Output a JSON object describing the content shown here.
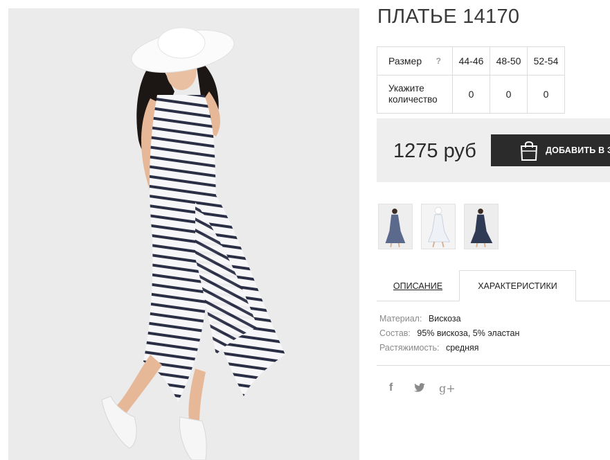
{
  "product": {
    "title": "ПЛАТЬЕ 14170",
    "price": "1275 руб",
    "add_to_cart_label": "ДОБАВИТЬ В ЗАКАЗ"
  },
  "size_table": {
    "size_label": "Размер",
    "help_mark": "?",
    "quantity_label": "Укажите количество",
    "sizes": [
      "44-46",
      "48-50",
      "52-54"
    ],
    "quantities": [
      "0",
      "0",
      "0"
    ]
  },
  "tabs": {
    "description": "ОПИСАНИЕ",
    "characteristics": "ХАРАКТЕРИСТИКИ",
    "active": "characteristics"
  },
  "characteristics": [
    {
      "key": "Материал:",
      "value": "Вискоза"
    },
    {
      "key": "Состав:",
      "value": "95% вискоза, 5% эластан"
    },
    {
      "key": "Растяжимость:",
      "value": "средняя"
    }
  ],
  "social": {
    "facebook": "f",
    "twitter": "twitter-bird",
    "googleplus": "g+"
  },
  "icons": {
    "cart": "shopping-bag-icon"
  },
  "colors": {
    "button_bg": "#2b2b2b",
    "price_block_bg": "#eeeeee",
    "border": "#dcdcdc",
    "muted_text": "#8a8a8a"
  }
}
